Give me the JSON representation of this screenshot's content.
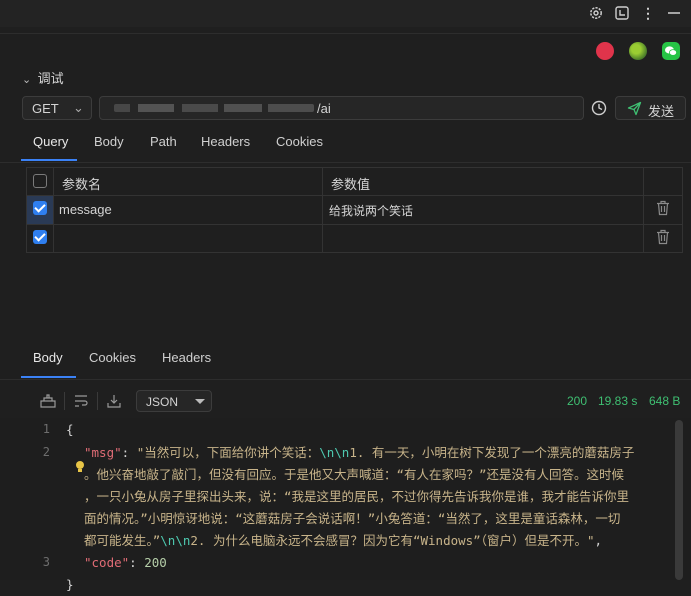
{
  "section": {
    "title": "调试"
  },
  "request": {
    "method": "GET",
    "url": "/ai",
    "send_label": "发送"
  },
  "request_tabs": [
    "Query",
    "Body",
    "Path",
    "Headers",
    "Cookies"
  ],
  "params_table": {
    "headers": [
      "参数名",
      "参数值"
    ],
    "rows": [
      {
        "checked": true,
        "name": "message",
        "value": "给我说两个笑话"
      },
      {
        "checked": true,
        "name": "",
        "value": ""
      }
    ]
  },
  "response_tabs": [
    "Body",
    "Cookies",
    "Headers"
  ],
  "response": {
    "format": "JSON",
    "status": "200",
    "time": "19.83 s",
    "size": "648 B",
    "line_numbers": [
      "1",
      "2",
      "3"
    ],
    "code": {
      "open_brace": "{",
      "msg_key": "\"msg\"",
      "colon": ": ",
      "msg_part1": "\"当然可以，下面给你讲个笑话：",
      "esc1": "\\n\\n",
      "msg_part2": "1. 有一天，小明在树下发现了一个漂亮的蘑菇房子",
      "msg_line2": "。他兴奋地敲了敲门，但没有回应。于是他又大声喊道：“有人在家吗？”还是没有人回答。这时候",
      "msg_line3": "，一只小兔从房子里探出头来，说：“我是这里的居民，不过你得先告诉我你是谁，我才能告诉你里",
      "msg_line4": "面的情况。”小明惊讶地说：“这蘑菇房子会说话啊！”小兔答道：“当然了，这里是童话森林，一切",
      "msg_line5a": "都可能发生。”",
      "esc2": "\\n\\n",
      "msg_line5b": "2. 为什么电脑永远不会感冒？因为它有“Windows”（窗户）但是不开。\"",
      "comma": ",",
      "code_key": "\"code\"",
      "code_val": "200",
      "close_brace": "}"
    }
  },
  "colors": {
    "accent": "#3b82f6",
    "success": "#3fbf72"
  }
}
